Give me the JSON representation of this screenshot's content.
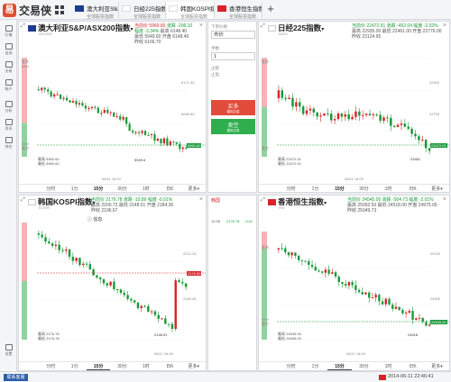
{
  "app": {
    "logo_mark": "易",
    "name": "交易侠"
  },
  "tabs": [
    {
      "title": "澳大利亚S&P...",
      "sub": "全球股票指数",
      "flag_color": "#1d3c8f"
    },
    {
      "title": "日经225指数",
      "sub": "全球股票指数",
      "flag_color": "#ffffff"
    },
    {
      "title": "韩国KOSPI指数",
      "sub": "全球股票指数",
      "flag_color": "#ffffff"
    },
    {
      "title": "香港恒生指数",
      "sub": "全球股票指数",
      "flag_color": "#d8232a"
    }
  ],
  "tab_close": "×",
  "plus_label": "+",
  "sidebar": [
    "行情",
    "自选",
    "交易",
    "账户",
    "分析",
    "资讯",
    "持仓",
    "设置",
    "日历"
  ],
  "timeframes": [
    "分时",
    "1分",
    "15分",
    "30分",
    "1时",
    "日K",
    "更多▾"
  ],
  "selected_timeframe": "15分",
  "panels": [
    {
      "title": "澳大利亚S&P/ASX200指数",
      "sub": "ASX200",
      "q1": "当前价 5960.60",
      "q2": "涨跌 -206.10",
      "q3": "幅度 -3.34%",
      "q4": "最高 6148.40",
      "q5": "最低 5949.60",
      "q6": "开盘 6148.40",
      "q7": "昨收 6166.70",
      "last_price": "5960.60",
      "low_label": "5949.6",
      "ohlc1": "最高 5960.60",
      "ohlc2": "最低 5960.60",
      "time_label": "06/11 16:00",
      "axis_top": "6171.50",
      "axis_mid": "6089.80",
      "pct_top": "66%",
      "pct_bot": "34%",
      "side_top": "看多",
      "side_bot": "看空"
    },
    {
      "title": "日经225指数",
      "sub": "N225",
      "q1": "当前价 22472.91",
      "q2": "涨跌 -452.04",
      "q3": "幅度 -2.02%",
      "q4": "最高 22935.00",
      "q5": "最低 22461.00",
      "q6": "开盘 22776.00",
      "q7": "昨收 23124.95",
      "last_price": "22472.91",
      "low_label": "23461",
      "ohlc1": "最高 22472.91",
      "ohlc2": "最低 22472.91",
      "time_label": "06/11 16:00",
      "axis_top": "22920",
      "axis_mid": "22700",
      "pct_top": "",
      "pct_bot": "",
      "side_top": "看多",
      "side_bot": "看空"
    },
    {
      "title": "韩国KOSPI指数",
      "sub": "KOSPI",
      "q1": "当前价 2176.78",
      "q2": "涨跌 -19.89",
      "q3": "幅度 -0.91%",
      "q4": "最高 2200.72",
      "q5": "最低 2148.51",
      "q6": "开盘 2184.36",
      "q7": "昨收 2196.67",
      "last_price": "2176.59",
      "low_label": "2148.51",
      "ohlc1": "最高 2176.78",
      "ohlc2": "最低 2176.78",
      "time_label": "06/11 16:00",
      "axis_top": "2212.25",
      "axis_mid": "2184.45",
      "pct_top": "",
      "pct_bot": "",
      "side_top": "看多",
      "side_bot": "看空",
      "info_label": "信息"
    },
    {
      "title": "香港恒生指数",
      "sub": "HSI",
      "q1": "当前价 24545.00",
      "q2": "涨跌 -504.73",
      "q3": "幅度 -2.01%",
      "q4": "最高 25092.50",
      "q5": "最低 24518.00",
      "q6": "开盘 24975.00",
      "q7": "昨收 25049.73",
      "last_price": "24545.00",
      "low_label": "24518",
      "ohlc1": "最高 24545.00",
      "ohlc2": "最低 24545.00",
      "time_label": "06/11 16:00",
      "axis_top": "25100",
      "axis_mid": "24900",
      "pct_top": "",
      "pct_bot": "84%",
      "side_top": "看多",
      "side_bot": "看空"
    }
  ],
  "order": {
    "type_label": "下单价格",
    "type_value": "市价",
    "qty_label": "手数",
    "qty_value": "1",
    "sl_label": "止损",
    "tp_label": "止盈",
    "buy_label": "买多",
    "buy_sub": "模拟交易",
    "sell_label": "卖空",
    "sell_sub": "模拟交易"
  },
  "mini": {
    "header": "韩国",
    "row1": "14.05",
    "row2": "2176.78",
    "row3": "-0.61"
  },
  "status": {
    "button": "联系客服",
    "time": "2014-06-11 22:46:41"
  },
  "colors": {
    "up": "#d8232a",
    "down": "#1a9a3a",
    "accent": "#2c5fa8"
  }
}
